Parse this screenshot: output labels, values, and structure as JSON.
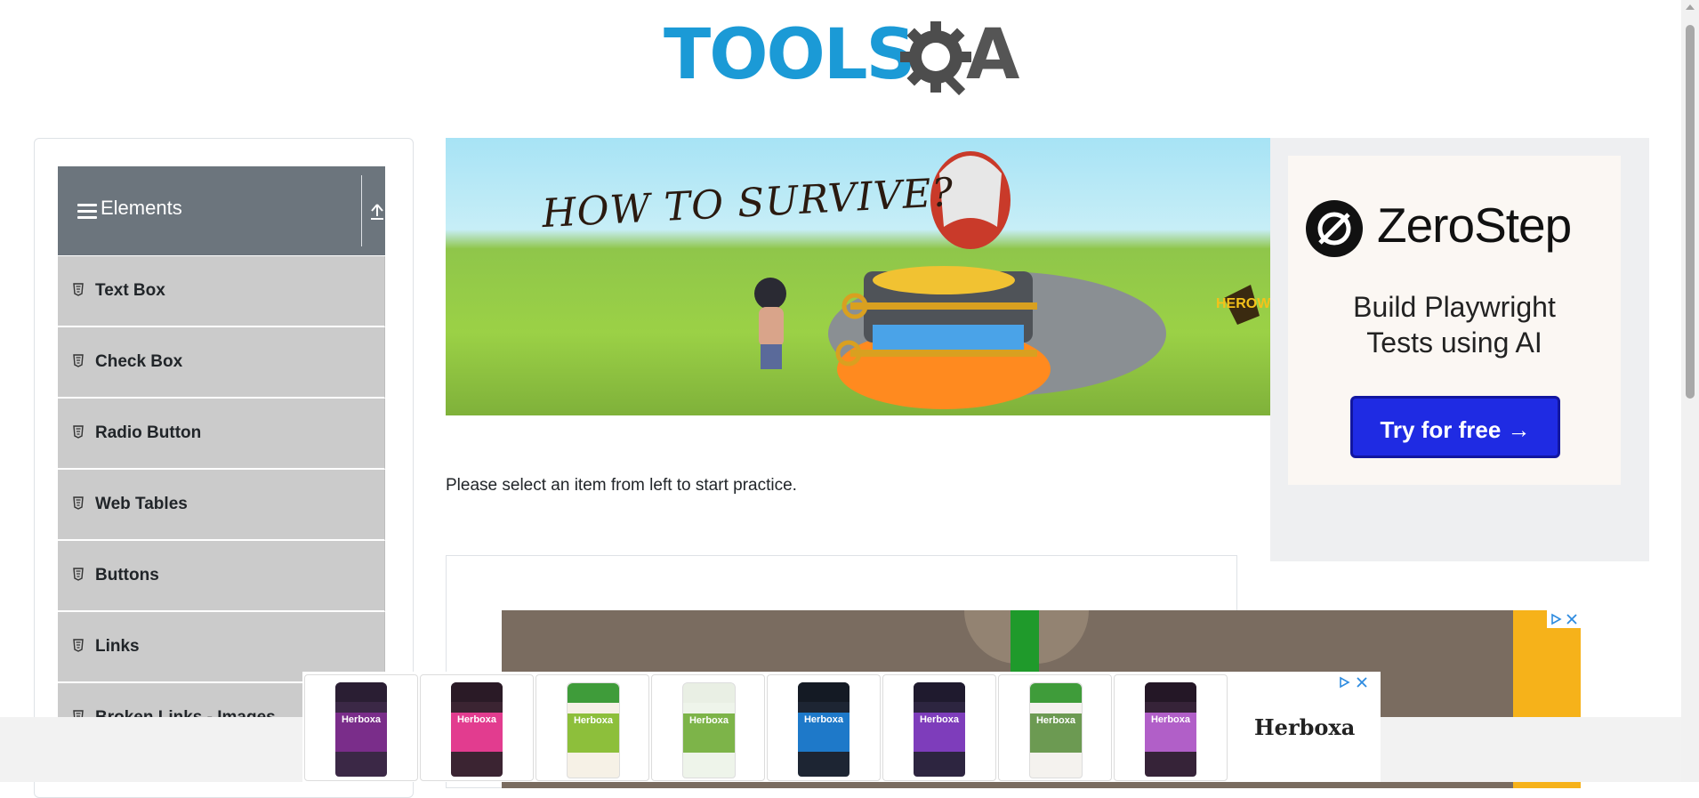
{
  "header": {
    "logo_text_main": "TOOLS",
    "logo_text_suffix": "A"
  },
  "sidebar": {
    "group_title": "Elements",
    "items": [
      {
        "label": "Text Box"
      },
      {
        "label": "Check Box"
      },
      {
        "label": "Radio Button"
      },
      {
        "label": "Web Tables"
      },
      {
        "label": "Buttons"
      },
      {
        "label": "Links"
      },
      {
        "label": "Broken Links - Images"
      }
    ]
  },
  "banner": {
    "headline": "HOW TO SURVIVE?",
    "brand": "HEROWA"
  },
  "side_ad": {
    "brand": "ZeroStep",
    "tagline_line1": "Build Playwright",
    "tagline_line2": "Tests using AI",
    "cta": "Try for free →"
  },
  "main": {
    "instruction": "Please select an item from left to start practice."
  },
  "bottom_ad": {
    "brand": "Herboxa",
    "products": [
      {
        "brand": "Herboxa",
        "color": "#3b2846",
        "label_color": "#7a2d8a"
      },
      {
        "brand": "Herboxa",
        "color": "#3b2432",
        "label_color": "#e23c8f"
      },
      {
        "brand": "Herboxa",
        "color": "#f6f1e6",
        "label_color": "#8dbf3b"
      },
      {
        "brand": "Herboxa",
        "color": "#eef4ea",
        "label_color": "#7db449"
      },
      {
        "brand": "Herboxa",
        "color": "#1d2533",
        "label_color": "#1e79c9"
      },
      {
        "brand": "Herboxa",
        "color": "#2d2540",
        "label_color": "#7e3dbb"
      },
      {
        "brand": "Herboxa",
        "color": "#f4f2ee",
        "label_color": "#6c9a52"
      },
      {
        "brand": "Herboxa",
        "color": "#362338",
        "label_color": "#b15fc8"
      }
    ]
  },
  "colors": {
    "sidebar_header": "#6c757d",
    "sidebar_item": "#cbcbcb",
    "logo_blue": "#1b9ad6",
    "cta_blue": "#1f2be3"
  }
}
